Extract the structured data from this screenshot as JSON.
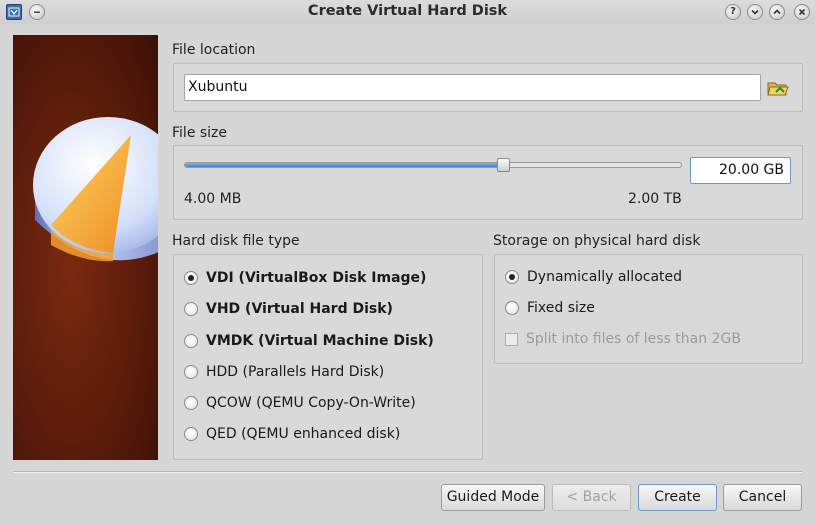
{
  "window": {
    "title": "Create Virtual Hard Disk",
    "icons": [
      "virtualbox-app-icon",
      "pin-icon",
      "help-icon",
      "minimize-icon",
      "maximize-icon",
      "close-icon"
    ]
  },
  "file_location": {
    "label": "File location",
    "value": "Xubuntu",
    "folder_icon": "folder-open-icon"
  },
  "file_size": {
    "label": "File size",
    "min_label": "4.00 MB",
    "max_label": "2.00 TB",
    "value": "20.00 GB",
    "slider_fraction": 0.64
  },
  "disk_type": {
    "label": "Hard disk file type",
    "options": [
      {
        "label": "VDI (VirtualBox Disk Image)",
        "selected": true
      },
      {
        "label": "VHD (Virtual Hard Disk)",
        "selected": false
      },
      {
        "label": "VMDK (Virtual Machine Disk)",
        "selected": false
      },
      {
        "label": "HDD (Parallels Hard Disk)",
        "selected": false
      },
      {
        "label": "QCOW (QEMU Copy-On-Write)",
        "selected": false
      },
      {
        "label": "QED (QEMU enhanced disk)",
        "selected": false
      }
    ]
  },
  "storage": {
    "label": "Storage on physical hard disk",
    "options": [
      {
        "label": "Dynamically allocated",
        "selected": true
      },
      {
        "label": "Fixed size",
        "selected": false
      }
    ],
    "split_label": "Split into files of less than 2GB",
    "split_checked": false,
    "split_enabled": false
  },
  "buttons": {
    "guided": "Guided Mode",
    "back": "< Back",
    "create": "Create",
    "cancel": "Cancel"
  },
  "colors": {
    "accent": "#3f86c8",
    "side_panel": "#5a1c0a"
  }
}
